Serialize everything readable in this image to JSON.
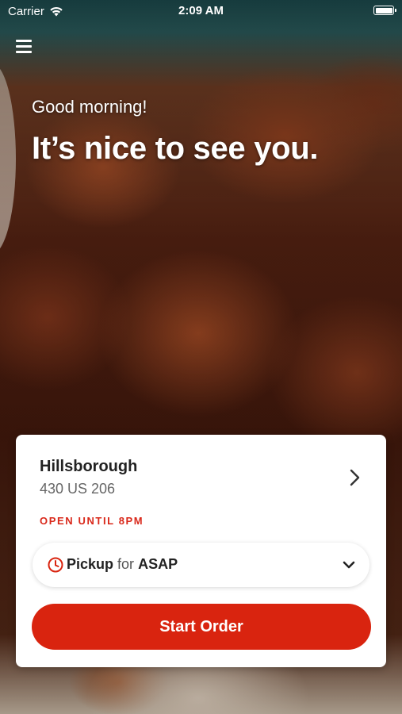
{
  "status_bar": {
    "carrier": "Carrier",
    "time": "2:09 AM"
  },
  "greeting": {
    "subtitle": "Good morning!",
    "title": "It’s nice to see you."
  },
  "location": {
    "name": "Hillsborough",
    "address": "430 US 206",
    "hours_status": "OPEN UNTIL 8PM"
  },
  "order_mode": {
    "mode": "Pickup",
    "connector": "for",
    "time": "ASAP"
  },
  "actions": {
    "start_order_label": "Start Order"
  },
  "colors": {
    "accent": "#d9240f",
    "status_text": "#d9281a"
  },
  "icons": {
    "menu": "hamburger-menu-icon",
    "wifi": "wifi-icon",
    "battery": "battery-icon",
    "chevron_right": "chevron-right-icon",
    "clock": "clock-icon",
    "chevron_down": "chevron-down-icon"
  }
}
